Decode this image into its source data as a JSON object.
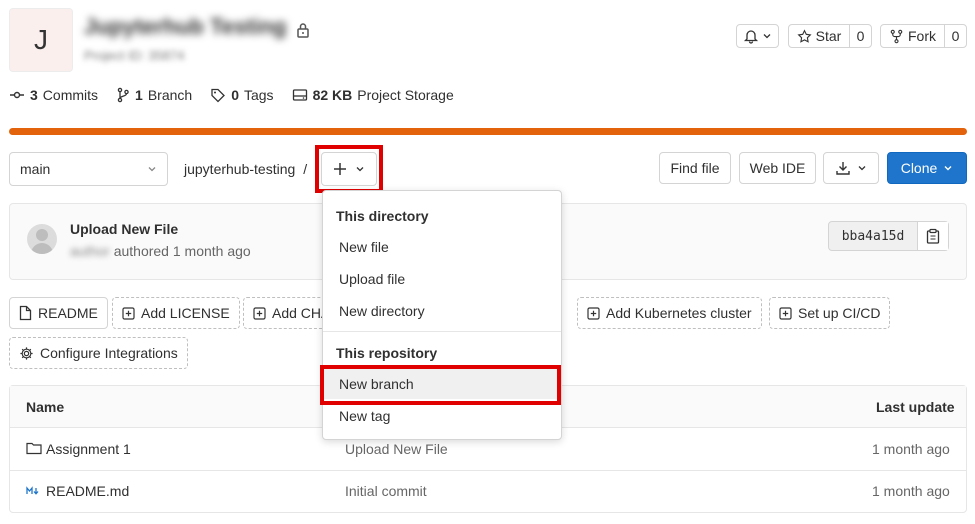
{
  "project": {
    "avatar_letter": "J",
    "name": "Jupyterhub Testing",
    "project_id": "Project ID: 35874"
  },
  "header_buttons": {
    "star_label": "Star",
    "star_count": "0",
    "fork_label": "Fork",
    "fork_count": "0"
  },
  "stats": {
    "commits_count": "3",
    "commits_label": "Commits",
    "branches_count": "1",
    "branches_label": "Branch",
    "tags_count": "0",
    "tags_label": "Tags",
    "storage_size": "82 KB",
    "storage_label": "Project Storage"
  },
  "storage_usage_fraction": 1.0,
  "toolbar": {
    "branch": "main",
    "path": "jupyterhub-testing",
    "separator": "/",
    "find_file": "Find file",
    "web_ide": "Web IDE",
    "clone": "Clone"
  },
  "last_commit": {
    "title": "Upload New File",
    "author": "author",
    "meta": "authored 1 month ago",
    "sha": "bba4a15d"
  },
  "quick_actions": {
    "readme": "README",
    "license": "Add LICENSE",
    "changelog": "Add CHANGELOG",
    "kubernetes": "Add Kubernetes cluster",
    "cicd": "Set up CI/CD",
    "integrations": "Configure Integrations"
  },
  "dropdown": {
    "section_directory": "This directory",
    "new_file": "New file",
    "upload_file": "Upload file",
    "new_directory": "New directory",
    "section_repository": "This repository",
    "new_branch": "New branch",
    "new_tag": "New tag"
  },
  "files": {
    "header_name": "Name",
    "header_last_update": "Last update",
    "rows": [
      {
        "name": "Assignment 1",
        "commit": "Upload New File",
        "updated": "1 month ago"
      },
      {
        "name": "README.md",
        "commit": "Initial commit",
        "updated": "1 month ago"
      }
    ]
  },
  "colors": {
    "primary_blue": "#1f75cb",
    "storage_bar": "#e2630b",
    "highlight_red": "#e00000"
  }
}
